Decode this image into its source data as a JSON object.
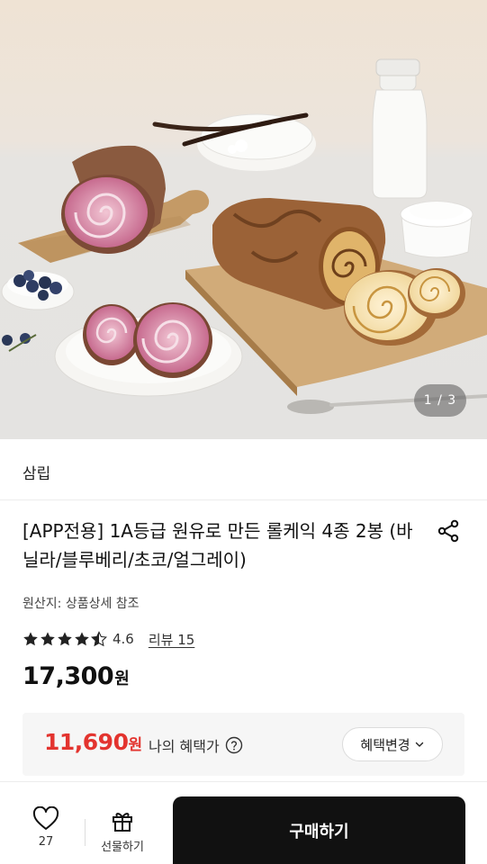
{
  "hero": {
    "counter_current": "1",
    "counter_total": "3",
    "counter_text": "1 / 3"
  },
  "brand": {
    "name": "삼립"
  },
  "product": {
    "title": "[APP전용] 1A등급 원유로 만든 롤케익 4종 2봉 (바닐라/블루베리/초코/얼그레이)",
    "origin_label": "원산지:",
    "origin_value": "상품상세 참조",
    "rating": 4.6,
    "rating_text": "4.6",
    "stars_filled": 4.5,
    "review_text": "리뷰 15",
    "price_number": "17,300",
    "price_unit": "원"
  },
  "benefit": {
    "price_number": "11,690",
    "price_unit": "원",
    "label": "나의 혜택가",
    "change_button": "혜택변경"
  },
  "bottom_bar": {
    "like_count": "27",
    "gift_label": "선물하기",
    "buy_label": "구매하기"
  },
  "colors": {
    "benefit_price": "#e3342f",
    "buy_button_bg": "#111111",
    "star": "#222222"
  },
  "icons": [
    "share-icon",
    "star-icon",
    "help-circle-icon",
    "chevron-down-icon",
    "heart-icon",
    "gift-icon"
  ]
}
